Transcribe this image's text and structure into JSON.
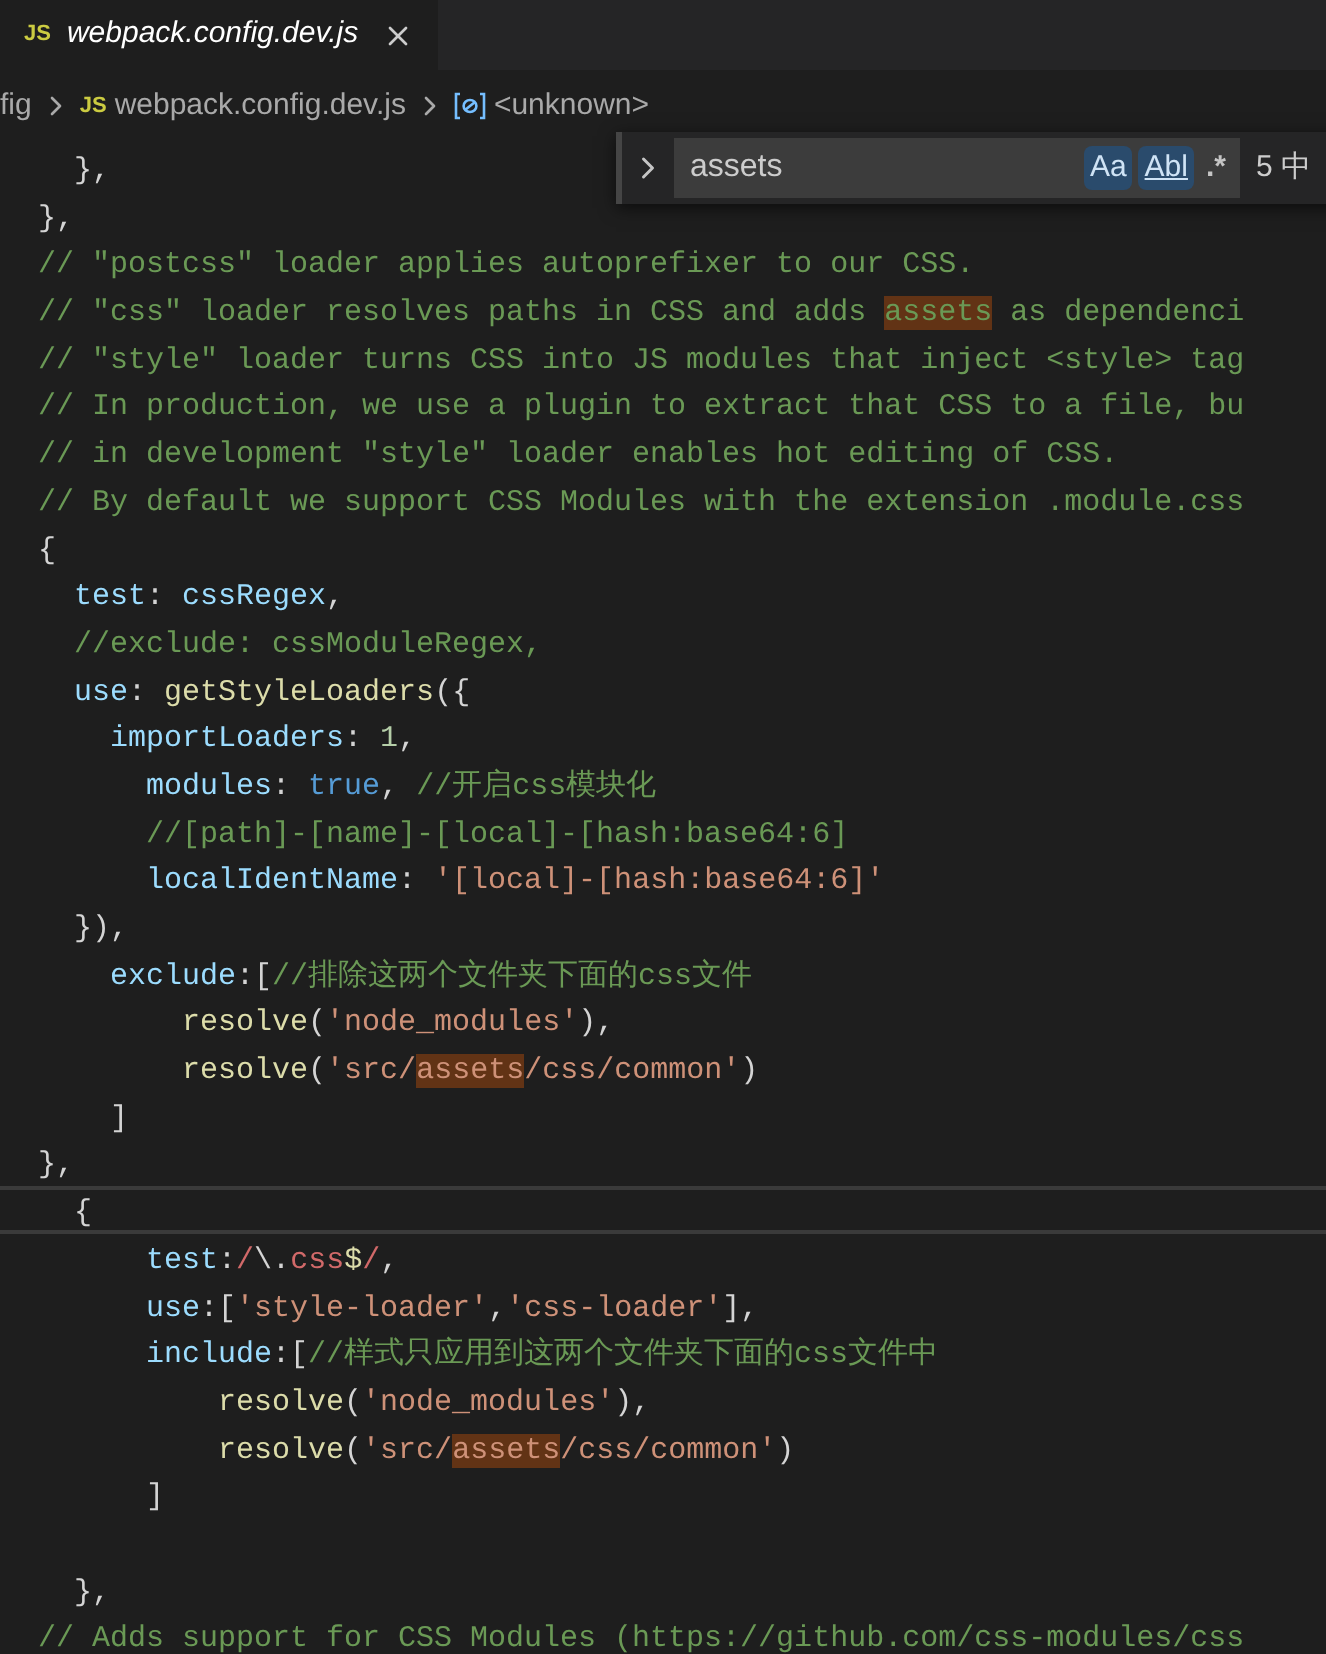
{
  "tab": {
    "icon_label": "JS",
    "title": "webpack.config.dev.js",
    "selected": true
  },
  "breadcrumb": [
    {
      "label": "fig",
      "kind": "folder"
    },
    {
      "label": "webpack.config.dev.js",
      "kind": "file",
      "icon_label": "JS"
    },
    {
      "label": "<unknown>",
      "kind": "symbol"
    }
  ],
  "find_widget": {
    "value": "assets",
    "options": [
      {
        "label": "Aa",
        "on": true,
        "kind": "case"
      },
      {
        "label": "Abl",
        "on": true,
        "kind": "word"
      },
      {
        "label": ".*",
        "on": false,
        "kind": "regex"
      }
    ],
    "count": "5 中"
  },
  "code_lines": [
    {
      "current": false,
      "tokens": [
        {
          "kind": "punct",
          "text": "  },",
          "match": false
        }
      ]
    },
    {
      "current": false,
      "tokens": [
        {
          "kind": "punct",
          "text": "},",
          "match": false
        }
      ]
    },
    {
      "current": false,
      "tokens": [
        {
          "kind": "comment",
          "text": "// \"postcss\" loader applies autoprefixer to our CSS.",
          "match": false
        }
      ]
    },
    {
      "current": false,
      "tokens": [
        {
          "kind": "comment",
          "text": "// \"css\" loader resolves paths in CSS and adds ",
          "match": false
        },
        {
          "kind": "comment",
          "text": "assets",
          "match": true
        },
        {
          "kind": "comment",
          "text": " as dependenci",
          "match": false
        }
      ]
    },
    {
      "current": false,
      "tokens": [
        {
          "kind": "comment",
          "text": "// \"style\" loader turns CSS into JS modules that inject <style> tag",
          "match": false
        }
      ]
    },
    {
      "current": false,
      "tokens": [
        {
          "kind": "comment",
          "text": "// In production, we use a plugin to extract that CSS to a file, bu",
          "match": false
        }
      ]
    },
    {
      "current": false,
      "tokens": [
        {
          "kind": "comment",
          "text": "// in development \"style\" loader enables hot editing of CSS.",
          "match": false
        }
      ]
    },
    {
      "current": false,
      "tokens": [
        {
          "kind": "comment",
          "text": "// By default we support CSS Modules with the extension .module.css",
          "match": false
        }
      ]
    },
    {
      "current": false,
      "tokens": [
        {
          "kind": "punct",
          "text": "{",
          "match": false
        }
      ]
    },
    {
      "current": false,
      "tokens": [
        {
          "kind": "property",
          "text": "  test",
          "match": false
        },
        {
          "kind": "punct",
          "text": ": ",
          "match": false
        },
        {
          "kind": "property",
          "text": "cssRegex",
          "match": false
        },
        {
          "kind": "punct",
          "text": ",",
          "match": false
        }
      ]
    },
    {
      "current": false,
      "tokens": [
        {
          "kind": "comment",
          "text": "  //exclude: cssModuleRegex,",
          "match": false
        }
      ]
    },
    {
      "current": false,
      "tokens": [
        {
          "kind": "property",
          "text": "  use",
          "match": false
        },
        {
          "kind": "punct",
          "text": ": ",
          "match": false
        },
        {
          "kind": "function",
          "text": "getStyleLoaders",
          "match": false
        },
        {
          "kind": "punct",
          "text": "({",
          "match": false
        }
      ]
    },
    {
      "current": false,
      "tokens": [
        {
          "kind": "property",
          "text": "    importLoaders",
          "match": false
        },
        {
          "kind": "punct",
          "text": ": ",
          "match": false
        },
        {
          "kind": "number",
          "text": "1",
          "match": false
        },
        {
          "kind": "punct",
          "text": ",",
          "match": false
        }
      ]
    },
    {
      "current": false,
      "tokens": [
        {
          "kind": "property",
          "text": "      modules",
          "match": false
        },
        {
          "kind": "punct",
          "text": ": ",
          "match": false
        },
        {
          "kind": "keyword",
          "text": "true",
          "match": false
        },
        {
          "kind": "punct",
          "text": ", ",
          "match": false
        },
        {
          "kind": "comment",
          "text": "//开启css模块化",
          "match": false
        }
      ]
    },
    {
      "current": false,
      "tokens": [
        {
          "kind": "comment",
          "text": "      //[path]-[name]-[local]-[hash:base64:6]",
          "match": false
        }
      ]
    },
    {
      "current": false,
      "tokens": [
        {
          "kind": "property",
          "text": "      localIdentName",
          "match": false
        },
        {
          "kind": "punct",
          "text": ": ",
          "match": false
        },
        {
          "kind": "string",
          "text": "'[local]-[hash:base64:6]'",
          "match": false
        }
      ]
    },
    {
      "current": false,
      "tokens": [
        {
          "kind": "punct",
          "text": "  }),",
          "match": false
        }
      ]
    },
    {
      "current": false,
      "tokens": [
        {
          "kind": "property",
          "text": "    exclude",
          "match": false
        },
        {
          "kind": "punct",
          "text": ":[",
          "match": false
        },
        {
          "kind": "comment",
          "text": "//排除这两个文件夹下面的css文件",
          "match": false
        }
      ]
    },
    {
      "current": false,
      "tokens": [
        {
          "kind": "function",
          "text": "        resolve",
          "match": false
        },
        {
          "kind": "punct",
          "text": "(",
          "match": false
        },
        {
          "kind": "string",
          "text": "'node_modules'",
          "match": false
        },
        {
          "kind": "punct",
          "text": "),",
          "match": false
        }
      ]
    },
    {
      "current": false,
      "tokens": [
        {
          "kind": "function",
          "text": "        resolve",
          "match": false
        },
        {
          "kind": "punct",
          "text": "(",
          "match": false
        },
        {
          "kind": "string",
          "text": "'src/",
          "match": false
        },
        {
          "kind": "string",
          "text": "assets",
          "match": true
        },
        {
          "kind": "string",
          "text": "/css/common'",
          "match": false
        },
        {
          "kind": "punct",
          "text": ")",
          "match": false
        }
      ]
    },
    {
      "current": false,
      "tokens": [
        {
          "kind": "punct",
          "text": "    ]",
          "match": false
        }
      ]
    },
    {
      "current": false,
      "tokens": [
        {
          "kind": "punct",
          "text": "},",
          "match": false
        }
      ]
    },
    {
      "current": true,
      "tokens": [
        {
          "kind": "punct",
          "text": "  {",
          "match": false
        }
      ]
    },
    {
      "current": false,
      "tokens": [
        {
          "kind": "property",
          "text": "      test",
          "match": false
        },
        {
          "kind": "punct",
          "text": ":",
          "match": false
        },
        {
          "kind": "regex",
          "text": "/",
          "match": false
        },
        {
          "kind": "punct",
          "text": "\\.",
          "match": false
        },
        {
          "kind": "regex",
          "text": "css",
          "match": false
        },
        {
          "kind": "anchor",
          "text": "$",
          "match": false
        },
        {
          "kind": "regex",
          "text": "/",
          "match": false
        },
        {
          "kind": "punct",
          "text": ",",
          "match": false
        }
      ]
    },
    {
      "current": false,
      "tokens": [
        {
          "kind": "property",
          "text": "      use",
          "match": false
        },
        {
          "kind": "punct",
          "text": ":[",
          "match": false
        },
        {
          "kind": "string",
          "text": "'style-loader'",
          "match": false
        },
        {
          "kind": "punct",
          "text": ",",
          "match": false
        },
        {
          "kind": "string",
          "text": "'css-loader'",
          "match": false
        },
        {
          "kind": "punct",
          "text": "],",
          "match": false
        }
      ]
    },
    {
      "current": false,
      "tokens": [
        {
          "kind": "property",
          "text": "      include",
          "match": false
        },
        {
          "kind": "punct",
          "text": ":[",
          "match": false
        },
        {
          "kind": "comment",
          "text": "//样式只应用到这两个文件夹下面的css文件中",
          "match": false
        }
      ]
    },
    {
      "current": false,
      "tokens": [
        {
          "kind": "function",
          "text": "          resolve",
          "match": false
        },
        {
          "kind": "punct",
          "text": "(",
          "match": false
        },
        {
          "kind": "string",
          "text": "'node_modules'",
          "match": false
        },
        {
          "kind": "punct",
          "text": "),",
          "match": false
        }
      ]
    },
    {
      "current": false,
      "tokens": [
        {
          "kind": "function",
          "text": "          resolve",
          "match": false
        },
        {
          "kind": "punct",
          "text": "(",
          "match": false
        },
        {
          "kind": "string",
          "text": "'src/",
          "match": false
        },
        {
          "kind": "string",
          "text": "assets",
          "match": true
        },
        {
          "kind": "string",
          "text": "/css/common'",
          "match": false
        },
        {
          "kind": "punct",
          "text": ")",
          "match": false
        }
      ]
    },
    {
      "current": false,
      "tokens": [
        {
          "kind": "punct",
          "text": "      ]",
          "match": false
        }
      ]
    },
    {
      "current": false
    },
    {
      "current": false,
      "tokens": [
        {
          "kind": "punct",
          "text": "  },",
          "match": false
        }
      ]
    },
    {
      "current": false,
      "tokens": [
        {
          "kind": "comment",
          "text": "// Adds support for CSS Modules (https://github.com/css-modules/css",
          "match": false
        }
      ]
    }
  ]
}
